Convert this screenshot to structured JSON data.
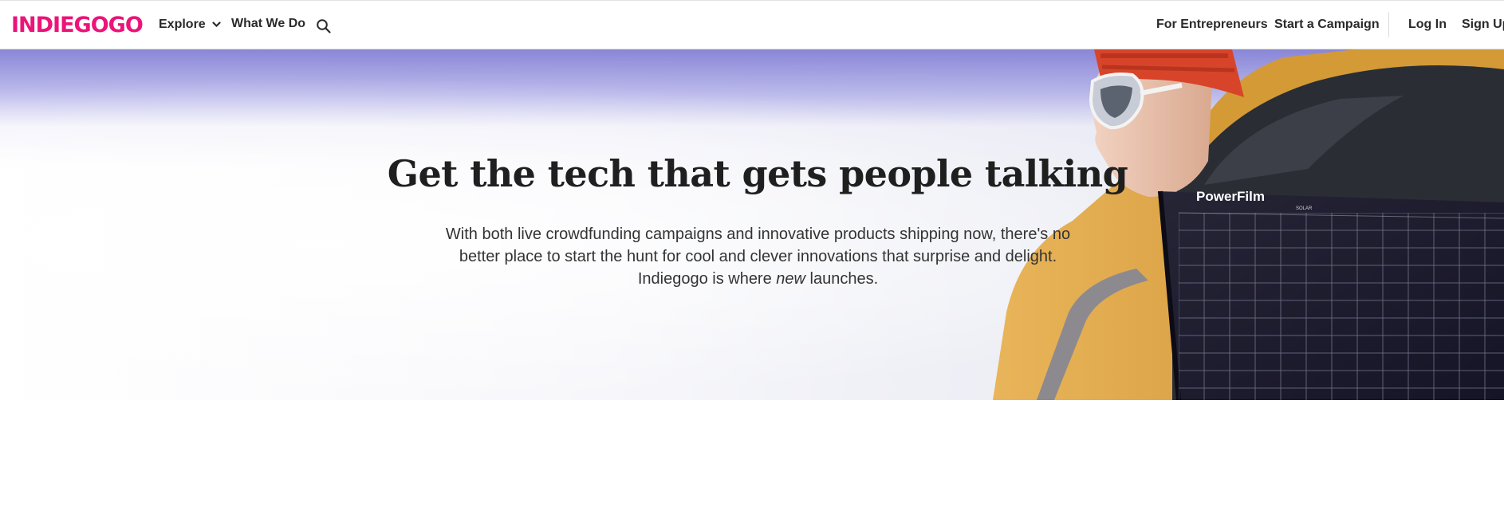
{
  "header": {
    "logo_text": "INDIEGOGO",
    "nav": {
      "explore": "Explore",
      "what_we_do": "What We Do",
      "for_entrepreneurs": "For Entrepreneurs",
      "start_campaign": "Start a Campaign",
      "log_in": "Log In",
      "sign_up": "Sign Up"
    },
    "icons": {
      "search": "search-icon",
      "explore_chevron": "chevron-down-icon"
    }
  },
  "hero": {
    "title": "Get the tech that gets people talking",
    "description_before": "With both live crowdfunding campaigns and innovative products shipping now, there's no better place to start the hunt for cool and clever innovations that surprise and delight. Indiegogo is where ",
    "description_emphasis": "new",
    "description_after": " launches.",
    "product_brand": "PowerFilm",
    "product_sub": "SOLAR"
  },
  "colors": {
    "brand": "#eb1478",
    "text": "#222222",
    "hat": "#d8442a",
    "jacket": "#e0a63a",
    "panel": "#1c1b2c"
  }
}
